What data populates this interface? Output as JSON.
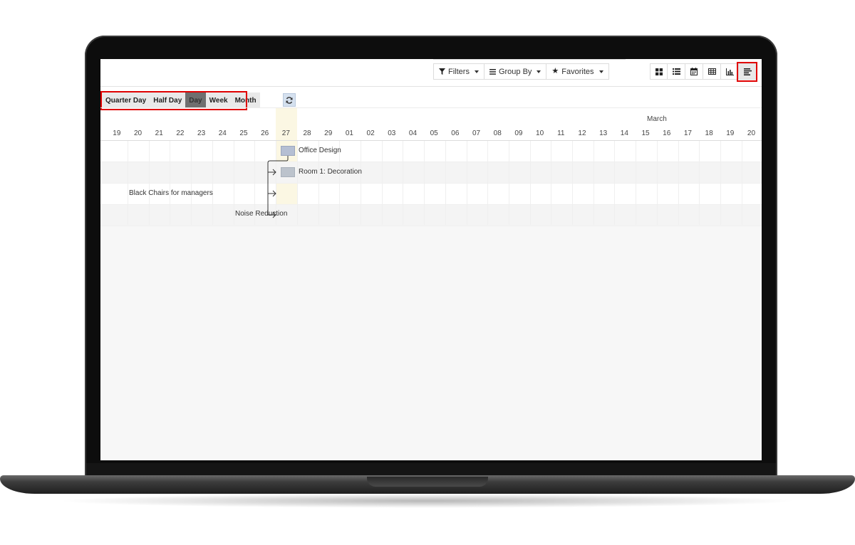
{
  "control_panel": {
    "filters_label": "Filters",
    "groupby_label": "Group By",
    "favorites_label": "Favorites",
    "filter_icon": "filter-icon",
    "groupby_icon": "list-icon",
    "favorites_icon": "star-icon",
    "views": [
      {
        "name": "kanban-view",
        "icon": "grid-icon"
      },
      {
        "name": "list-view",
        "icon": "list-icon"
      },
      {
        "name": "calendar-view",
        "icon": "calendar-icon"
      },
      {
        "name": "pivot-view",
        "icon": "table-icon"
      },
      {
        "name": "graph-view",
        "icon": "bar-chart-icon"
      },
      {
        "name": "gantt-view",
        "icon": "gantt-icon",
        "active": true
      }
    ]
  },
  "gantt": {
    "scales": [
      "Quarter Day",
      "Half Day",
      "Day",
      "Week",
      "Month"
    ],
    "active_scale": "Day",
    "refresh_icon": "refresh-icon",
    "month_label": "March",
    "days": [
      "19",
      "20",
      "21",
      "22",
      "23",
      "24",
      "25",
      "26",
      "27",
      "28",
      "29",
      "01",
      "02",
      "03",
      "04",
      "05",
      "06",
      "07",
      "08",
      "09",
      "10",
      "11",
      "12",
      "13",
      "14",
      "15",
      "16",
      "17",
      "18",
      "19",
      "20"
    ],
    "today": "27",
    "tasks": [
      {
        "label": "Office Design"
      },
      {
        "label": "Room 1: Decoration"
      },
      {
        "label": "Black Chairs for managers"
      },
      {
        "label": "Noise Reduction"
      }
    ]
  },
  "colors": {
    "highlight": "#e00000",
    "today_column": "#fbf7e3",
    "task_bar": "#b5bfd3"
  }
}
